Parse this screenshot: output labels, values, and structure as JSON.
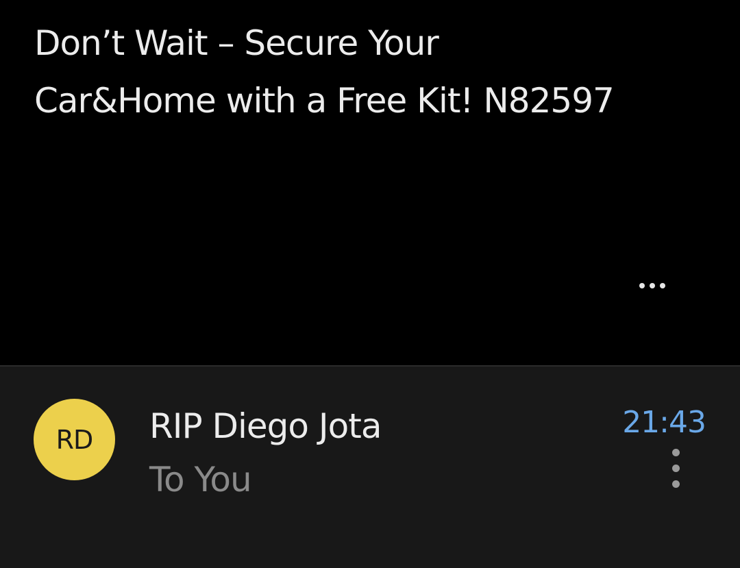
{
  "email": {
    "subject_line_1": "Don’t Wait – Secure Your",
    "subject_line_2": "Car&Home with a Free Kit! N82597",
    "more_icon": "horizontal-ellipsis-icon"
  },
  "sender": {
    "initials": "RD",
    "avatar_color": "#ecd04c",
    "name": "RIP Diego Jota",
    "recipient": "To You",
    "time": "21:43",
    "time_color": "#6aa8e8",
    "menu_icon": "vertical-ellipsis-icon"
  }
}
